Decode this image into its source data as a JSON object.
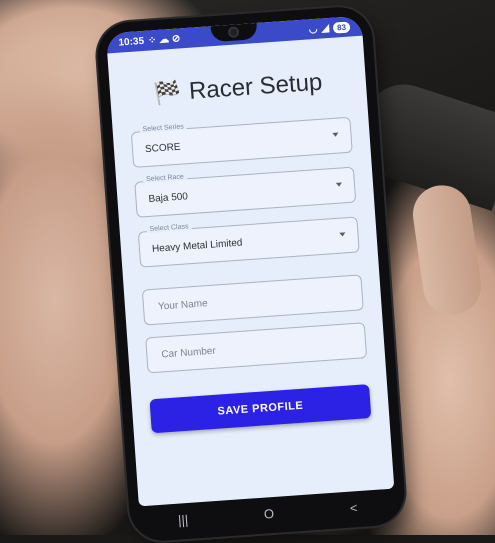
{
  "status_bar": {
    "time": "10:35",
    "battery": "83"
  },
  "app": {
    "title": "Racer Setup"
  },
  "form": {
    "series": {
      "label": "Select Series",
      "value": "SCORE"
    },
    "race": {
      "label": "Select Race",
      "value": "Baja 500"
    },
    "class": {
      "label": "Select Class",
      "value": "Heavy Metal Limited"
    },
    "name": {
      "placeholder": "Your Name"
    },
    "car_number": {
      "placeholder": "Car Number"
    },
    "save_label": "SAVE PROFILE"
  },
  "icons": {
    "flag": "checkered-flag",
    "dropdown": "chevron-down",
    "nav_recents": "|||",
    "nav_home": "O",
    "nav_back": "<"
  },
  "colors": {
    "accent": "#2b22e6",
    "status_bar": "#3a4ac8",
    "screen_bg": "#e6eefb"
  }
}
